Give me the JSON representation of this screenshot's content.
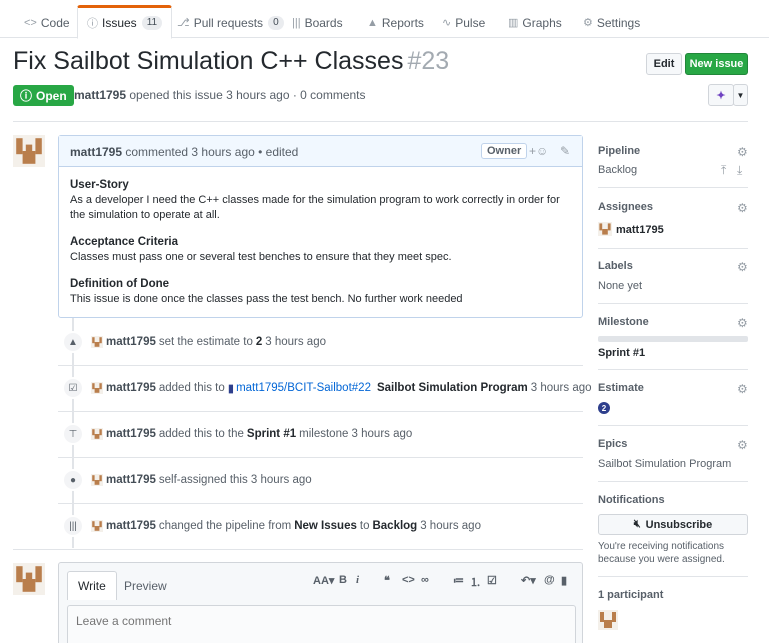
{
  "tabs": [
    {
      "label": "Code",
      "icon": "code-icon",
      "counter": ""
    },
    {
      "label": "Issues",
      "icon": "issue-icon",
      "counter": "11"
    },
    {
      "label": "Pull requests",
      "icon": "pull-request-icon",
      "counter": "0"
    },
    {
      "label": "Boards",
      "icon": "boards-icon",
      "counter": ""
    },
    {
      "label": "Reports",
      "icon": "reports-icon",
      "counter": ""
    },
    {
      "label": "Pulse",
      "icon": "pulse-icon",
      "counter": ""
    },
    {
      "label": "Graphs",
      "icon": "graphs-icon",
      "counter": ""
    },
    {
      "label": "Settings",
      "icon": "gear-icon",
      "counter": ""
    }
  ],
  "issue": {
    "title": "Fix Sailbot Simulation C++ Classes",
    "number": "#23",
    "state": "Open",
    "author": "matt1795",
    "meta": "opened this issue 3 hours ago · 0 comments"
  },
  "header_buttons": {
    "edit": "Edit",
    "new_issue": "New issue"
  },
  "comment": {
    "author": "matt1795",
    "meta": "commented 3 hours ago • edited",
    "owner_label": "Owner",
    "sections": [
      {
        "heading": "User-Story",
        "text": "As a developer I need the C++ classes made for the simulation program to work correctly in order for the simulation to operate at all."
      },
      {
        "heading": "Acceptance Criteria",
        "text": "Classes must pass one or several test benches to ensure that they meet spec."
      },
      {
        "heading": "Definition of Done",
        "text": "This issue is done once the classes pass the test bench. No further work needed"
      }
    ]
  },
  "timeline": [
    {
      "icon": "estimate-icon",
      "user": "matt1795",
      "t1": "set the estimate to",
      "s1": "2",
      "t2": "3 hours ago"
    },
    {
      "icon": "board-icon",
      "user": "matt1795",
      "t1": "added this to",
      "link": "matt1795/BCIT-Sailbot#22",
      "s1": "Sailbot Simulation Program",
      "t2": "3 hours ago"
    },
    {
      "icon": "milestone-icon",
      "user": "matt1795",
      "t1": "added this to the",
      "s1": "Sprint #1",
      "t2": "milestone 3 hours ago"
    },
    {
      "icon": "person-icon",
      "user": "matt1795",
      "t1": "self-assigned this 3 hours ago"
    },
    {
      "icon": "pipeline-icon",
      "user": "matt1795",
      "t1": "changed the pipeline from",
      "s1": "New Issues",
      "t2": "to",
      "s2": "Backlog",
      "t3": "3 hours ago"
    }
  ],
  "editor": {
    "write_tab": "Write",
    "preview_tab": "Preview",
    "placeholder": "Leave a comment",
    "toolbar": {
      "header": "AA",
      "bold": "B",
      "italic": "i"
    }
  },
  "sidebar": {
    "pipeline": {
      "label": "Pipeline",
      "value": "Backlog"
    },
    "assignees": {
      "label": "Assignees",
      "value": "matt1795"
    },
    "labels": {
      "label": "Labels",
      "value": "None yet"
    },
    "milestone": {
      "label": "Milestone",
      "value": "Sprint #1"
    },
    "estimate": {
      "label": "Estimate",
      "value": "2"
    },
    "epics": {
      "label": "Epics",
      "value": "Sailbot Simulation Program"
    },
    "notifications": {
      "label": "Notifications",
      "button": "Unsubscribe",
      "note": "You're receiving notifications because you were assigned."
    },
    "participants": {
      "label": "1 participant"
    }
  }
}
